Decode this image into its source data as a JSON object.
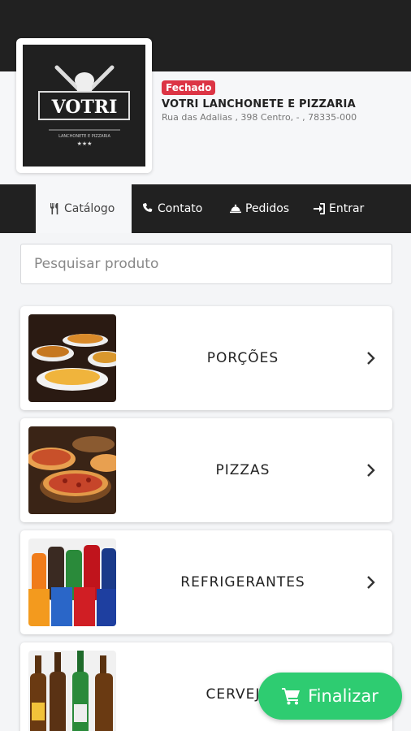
{
  "store": {
    "status": "Fechado",
    "name": "VOTRI LANCHONETE E PIZZARIA",
    "address": "Rua das Adalias , 398 Centro, - , 78335-000",
    "logo_text": "VOTRI",
    "logo_subtext": "LANCHONETE E PIZZARIA"
  },
  "nav": {
    "tabs": [
      {
        "label": "Catálogo",
        "icon": "utensils-icon"
      },
      {
        "label": "Contato",
        "icon": "phone-icon"
      },
      {
        "label": "Pedidos",
        "icon": "cloche-icon"
      },
      {
        "label": "Entrar",
        "icon": "sign-in-icon"
      }
    ]
  },
  "search": {
    "placeholder": "Pesquisar produto"
  },
  "categories": [
    {
      "label": "PORÇÕES"
    },
    {
      "label": "PIZZAS"
    },
    {
      "label": "REFRIGERANTES"
    },
    {
      "label": "CERVEJAS"
    }
  ],
  "checkout": {
    "label": "Finalizar",
    "icon": "cart-icon"
  },
  "colors": {
    "topbar": "#212121",
    "badge": "#dc3545",
    "checkout": "#2ecc71"
  }
}
